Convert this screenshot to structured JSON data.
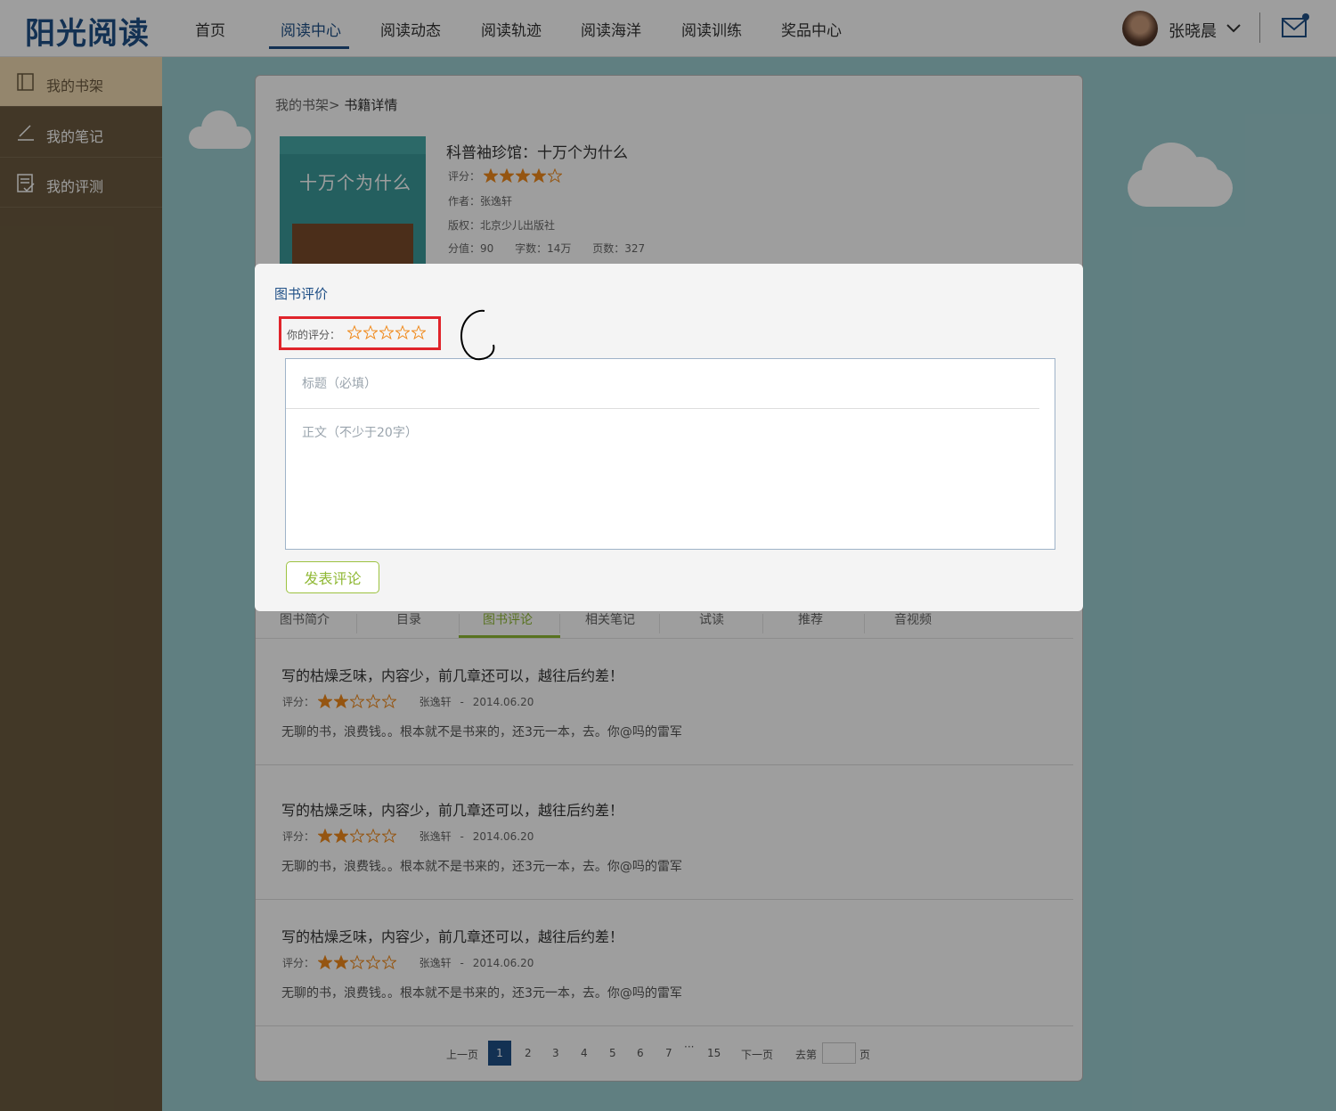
{
  "app": {
    "logo_text": "阳光阅读"
  },
  "nav": {
    "items": [
      {
        "label": "首页"
      },
      {
        "label": "阅读中心"
      },
      {
        "label": "阅读动态"
      },
      {
        "label": "阅读轨迹"
      },
      {
        "label": "阅读海洋"
      },
      {
        "label": "阅读训练"
      },
      {
        "label": "奖品中心"
      }
    ],
    "active_index": 1,
    "user": {
      "name": "张晓晨"
    }
  },
  "sidebar": {
    "items": [
      {
        "label": "我的书架",
        "icon": "bookshelf-icon"
      },
      {
        "label": "我的笔记",
        "icon": "pencil-icon"
      },
      {
        "label": "我的评测",
        "icon": "checklist-icon"
      }
    ],
    "active_index": 0
  },
  "breadcrumb": {
    "root": "我的书架>",
    "current": "书籍详情"
  },
  "book": {
    "cover_title": "十万个为什么",
    "title": "科普袖珍馆：十万个为什么",
    "rating_label": "评分：",
    "rating": 4,
    "author_label": "作者：张逸轩",
    "publisher_label": "版权：北京少儿出版社",
    "score_label": "分值：90",
    "words_label": "字数：14万",
    "pages_label": "页数：327"
  },
  "tabs": {
    "items": [
      "图书简介",
      "目录",
      "图书评论",
      "相关笔记",
      "试读",
      "推荐",
      "音视频"
    ],
    "active_index": 2
  },
  "reviews": [
    {
      "title": "写的枯燥乏味，内容少，前几章还可以，越往后约差！",
      "rating_label": "评分：",
      "rating": 2,
      "author": "张逸轩",
      "sep": "-",
      "date": "2014.06.20",
      "body": "无聊的书，浪费钱。。根本就不是书来的，还3元一本，去。你@吗的雷军"
    },
    {
      "title": "写的枯燥乏味，内容少，前几章还可以，越往后约差！",
      "rating_label": "评分：",
      "rating": 2,
      "author": "张逸轩",
      "sep": "-",
      "date": "2014.06.20",
      "body": "无聊的书，浪费钱。。根本就不是书来的，还3元一本，去。你@吗的雷军"
    },
    {
      "title": "写的枯燥乏味，内容少，前几章还可以，越往后约差！",
      "rating_label": "评分：",
      "rating": 2,
      "author": "张逸轩",
      "sep": "-",
      "date": "2014.06.20",
      "body": "无聊的书，浪费钱。。根本就不是书来的，还3元一本，去。你@吗的雷军"
    }
  ],
  "pagination": {
    "prev": "上一页",
    "pages": [
      "1",
      "2",
      "3",
      "4",
      "5",
      "6",
      "7"
    ],
    "ellipsis": "···",
    "last": "15",
    "next": "下一页",
    "goto_prefix": "去第",
    "goto_suffix": "页",
    "current": 1
  },
  "modal": {
    "title": "图书评价",
    "your_rating_label": "你的评分：",
    "your_rating": 0,
    "title_placeholder": "标题（必填）",
    "body_placeholder": "正文（不少于20字）",
    "submit_label": "发表评论"
  },
  "colors": {
    "brand": "#1f4f86",
    "accent_green": "#8fb834",
    "star": "#f08a1c",
    "highlight_red": "#e0242b"
  }
}
